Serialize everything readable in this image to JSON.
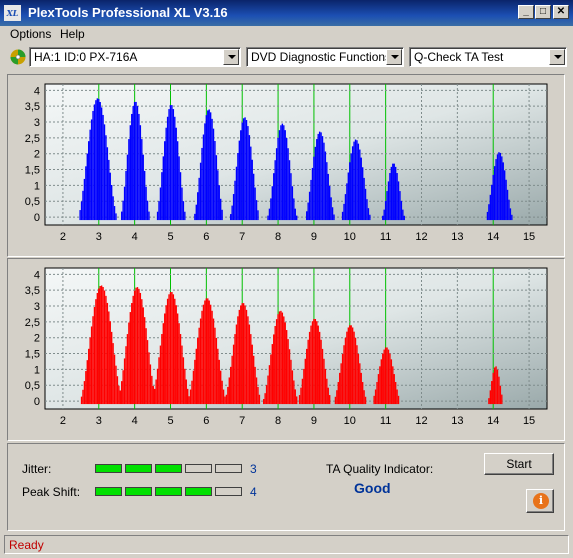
{
  "window": {
    "icon_text": "XL",
    "title": "PlexTools Professional XL V3.16",
    "minimize_glyph": "_",
    "maximize_glyph": "□",
    "close_glyph": "✕"
  },
  "menu": {
    "items": [
      "Options",
      "Help"
    ]
  },
  "toolbar": {
    "drive": "HA:1 ID:0  PX-716A",
    "function": "DVD Diagnostic Functions",
    "test": "Q-Check TA Test"
  },
  "colors": {
    "top_series": "#0000ff",
    "bottom_series": "#ff0000",
    "gridline_green": "#00c000",
    "good": "#003399"
  },
  "chart_data": [
    {
      "type": "bar",
      "x_ticks": [
        2,
        3,
        4,
        5,
        6,
        7,
        8,
        9,
        10,
        11,
        12,
        13,
        14,
        15
      ],
      "y_ticks": [
        "0",
        "0,5",
        "1",
        "1,5",
        "2",
        "2,5",
        "3",
        "3,5",
        "4"
      ],
      "xlim": [
        1.5,
        15.5
      ],
      "ylim": [
        -0.25,
        4.2
      ],
      "grid": true,
      "highlight_x": [
        3,
        4,
        5,
        6,
        7,
        8,
        9,
        10,
        11,
        14
      ],
      "peaks": [
        {
          "center": 2.95,
          "height": 3.75,
          "width": 0.55
        },
        {
          "center": 4.0,
          "height": 3.65,
          "width": 0.42
        },
        {
          "center": 5.0,
          "height": 3.55,
          "width": 0.42
        },
        {
          "center": 6.05,
          "height": 3.4,
          "width": 0.42
        },
        {
          "center": 7.05,
          "height": 3.15,
          "width": 0.42
        },
        {
          "center": 8.1,
          "height": 2.95,
          "width": 0.42
        },
        {
          "center": 9.15,
          "height": 2.7,
          "width": 0.42
        },
        {
          "center": 10.15,
          "height": 2.45,
          "width": 0.42
        },
        {
          "center": 11.2,
          "height": 1.7,
          "width": 0.32
        },
        {
          "center": 14.15,
          "height": 2.05,
          "width": 0.38
        }
      ]
    },
    {
      "type": "bar",
      "x_ticks": [
        2,
        3,
        4,
        5,
        6,
        7,
        8,
        9,
        10,
        11,
        12,
        13,
        14,
        15
      ],
      "y_ticks": [
        "0",
        "0,5",
        "1",
        "1,5",
        "2",
        "2,5",
        "3",
        "3,5",
        "4"
      ],
      "xlim": [
        1.5,
        15.5
      ],
      "ylim": [
        -0.25,
        4.2
      ],
      "grid": true,
      "highlight_x": [
        3,
        4,
        5,
        6,
        7,
        8,
        9,
        10,
        11,
        14
      ],
      "peaks": [
        {
          "center": 3.05,
          "height": 3.65,
          "width": 0.6
        },
        {
          "center": 4.05,
          "height": 3.6,
          "width": 0.55
        },
        {
          "center": 5.0,
          "height": 3.45,
          "width": 0.55
        },
        {
          "center": 6.0,
          "height": 3.25,
          "width": 0.55
        },
        {
          "center": 7.0,
          "height": 3.1,
          "width": 0.52
        },
        {
          "center": 8.05,
          "height": 2.85,
          "width": 0.5
        },
        {
          "center": 9.0,
          "height": 2.6,
          "width": 0.48
        },
        {
          "center": 10.0,
          "height": 2.4,
          "width": 0.47
        },
        {
          "center": 11.0,
          "height": 1.7,
          "width": 0.4
        },
        {
          "center": 14.05,
          "height": 1.1,
          "width": 0.22
        }
      ]
    }
  ],
  "results": {
    "jitter_label": "Jitter:",
    "jitter_value": "3",
    "jitter_level": 3,
    "peak_label": "Peak Shift:",
    "peak_value": "4",
    "peak_level": 4,
    "segments_total": 5,
    "ta_label": "TA Quality Indicator:",
    "ta_value": "Good",
    "start_label": "Start",
    "info_glyph": "i"
  },
  "status": {
    "text": "Ready"
  }
}
